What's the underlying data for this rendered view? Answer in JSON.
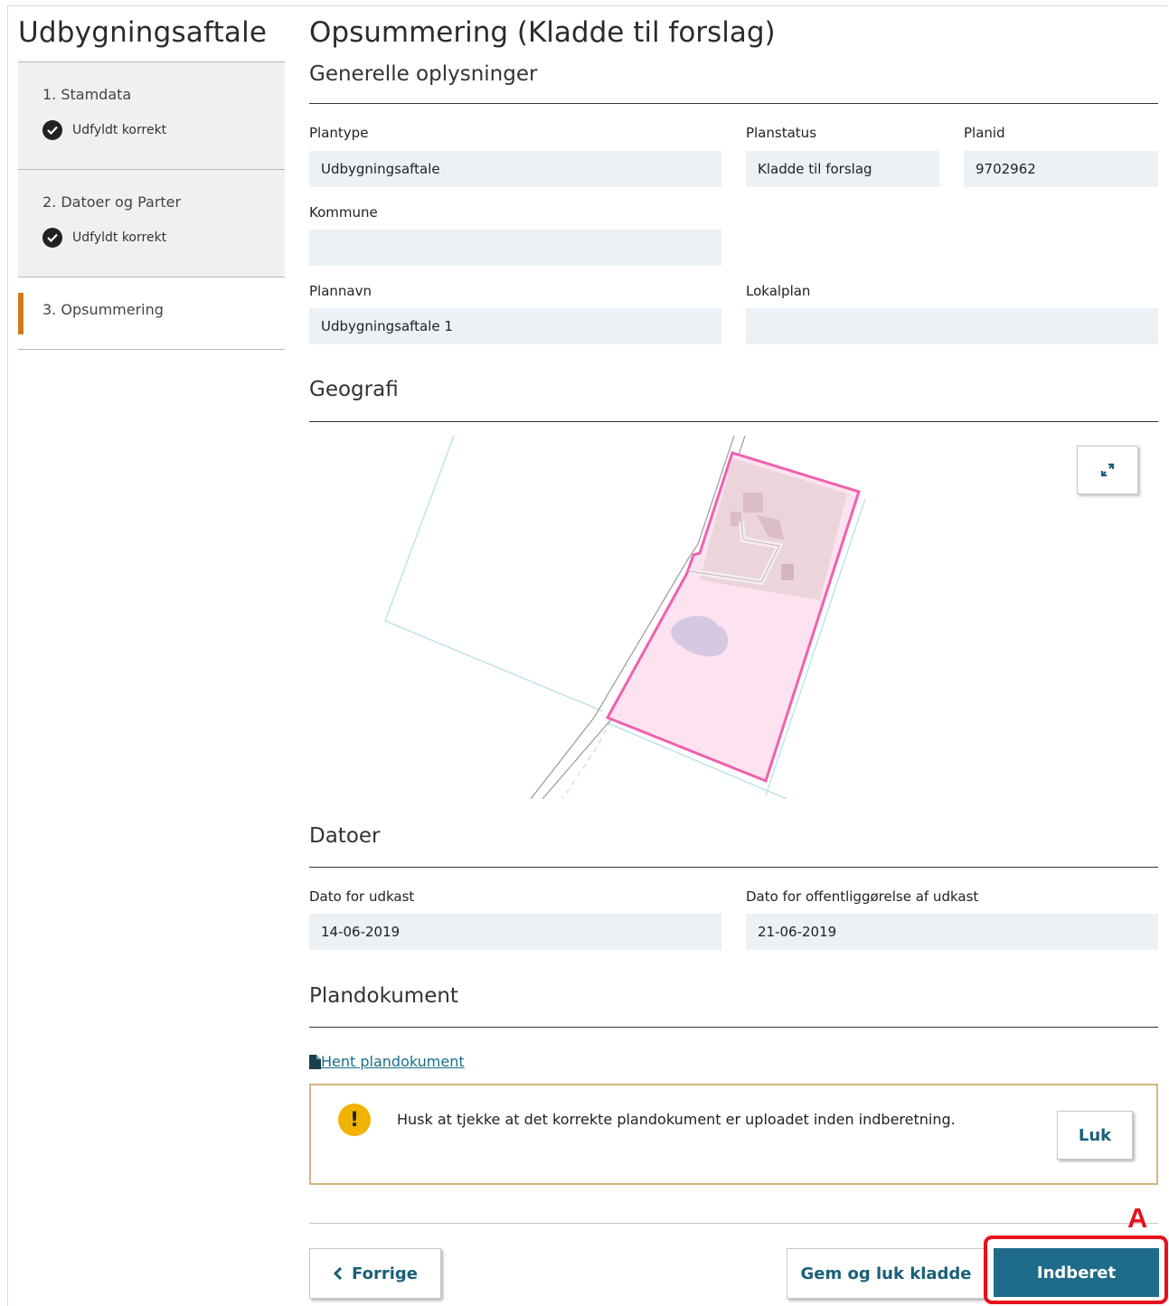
{
  "sidebar": {
    "title": "Udbygningsaftale",
    "steps": [
      {
        "label": "1. Stamdata",
        "status": "Udfyldt korrekt"
      },
      {
        "label": "2. Datoer og Parter",
        "status": "Udfyldt korrekt"
      },
      {
        "label": "3. Opsummering"
      }
    ]
  },
  "main": {
    "title": "Opsummering (Kladde til forslag)",
    "general": {
      "title": "Generelle oplysninger",
      "plantype": {
        "label": "Plantype",
        "value": "Udbygningsaftale"
      },
      "planstatus": {
        "label": "Planstatus",
        "value": "Kladde til forslag"
      },
      "planid": {
        "label": "Planid",
        "value": "9702962"
      },
      "kommune": {
        "label": "Kommune",
        "value": ""
      },
      "plannavn": {
        "label": "Plannavn",
        "value": "Udbygningsaftale 1"
      },
      "lokalplan": {
        "label": "Lokalplan",
        "value": ""
      }
    },
    "geografi": {
      "title": "Geografi",
      "expand_icon": "expand-icon"
    },
    "datoer": {
      "title": "Datoer",
      "udkast": {
        "label": "Dato for udkast",
        "value": "14-06-2019"
      },
      "offentlig": {
        "label": "Dato for offentliggørelse af udkast",
        "value": "21-06-2019"
      }
    },
    "plandokument": {
      "title": "Plandokument",
      "link": " Hent plandokument",
      "warning": "Husk at tjekke at det korrekte plandokument er uploadet inden indberetning.",
      "close_label": "Luk"
    }
  },
  "footer": {
    "prev_label": "Forrige",
    "save_label": "Gem og luk kladde",
    "submit_label": "Indberet"
  },
  "annotation": {
    "label": "A",
    "color": "#e8101c"
  },
  "colors": {
    "accent": "#1f6b8a",
    "step_marker": "#d07b1f",
    "plan_area": "#f060b0",
    "warning_border": "#d5b57d"
  }
}
